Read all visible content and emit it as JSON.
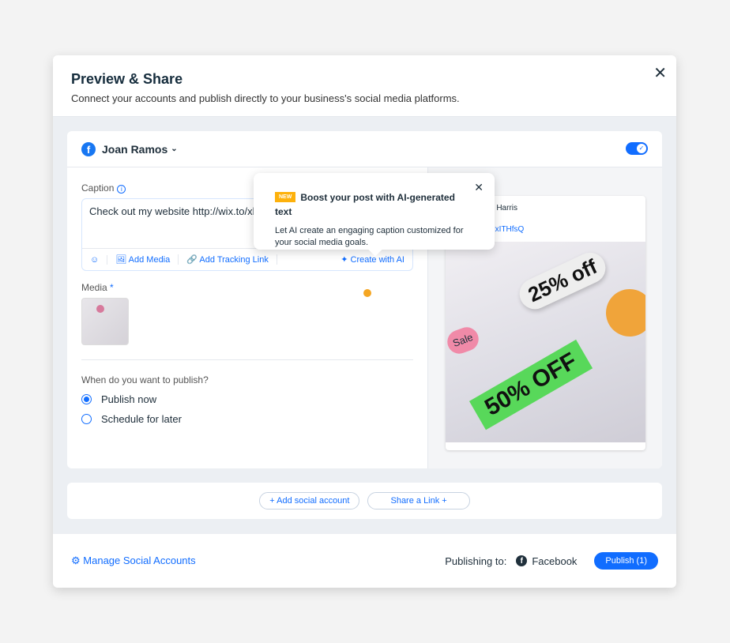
{
  "header": {
    "title": "Preview & Share",
    "subtitle": "Connect your accounts and publish directly to your business's social media platforms."
  },
  "account": {
    "name": "Joan Ramos",
    "enabled": true,
    "platform_icon": "facebook-icon"
  },
  "caption": {
    "label": "Caption",
    "value": "Check out my website http://wix.to/xl"
  },
  "toolbar": {
    "add_media": "Add Media",
    "add_tracking": "Add Tracking Link",
    "create_ai": "Create with AI"
  },
  "media": {
    "label": "Media",
    "required": "*"
  },
  "publish": {
    "question": "When do you want to publish?",
    "options": [
      {
        "label": "Publish now",
        "selected": true
      },
      {
        "label": "Schedule for later",
        "selected": false
      }
    ]
  },
  "preview": {
    "name": "a Harris",
    "link": "PxITHfsQ",
    "image_texts": [
      "25% off",
      "50% OFF",
      "Sale"
    ]
  },
  "tooltip": {
    "badge": "NEW",
    "title": "Boost your post with AI-generated text",
    "body": "Let AI create an engaging caption customized for your social media goals."
  },
  "actions": {
    "add_account": "+ Add social account",
    "share_link": "Share a Link  +"
  },
  "footer": {
    "manage": "Manage Social Accounts",
    "publishing_to": "Publishing to:",
    "platform": "Facebook",
    "publish_button": "Publish (1)"
  },
  "colors": {
    "accent": "#116dff",
    "badge": "#fdb10c"
  }
}
